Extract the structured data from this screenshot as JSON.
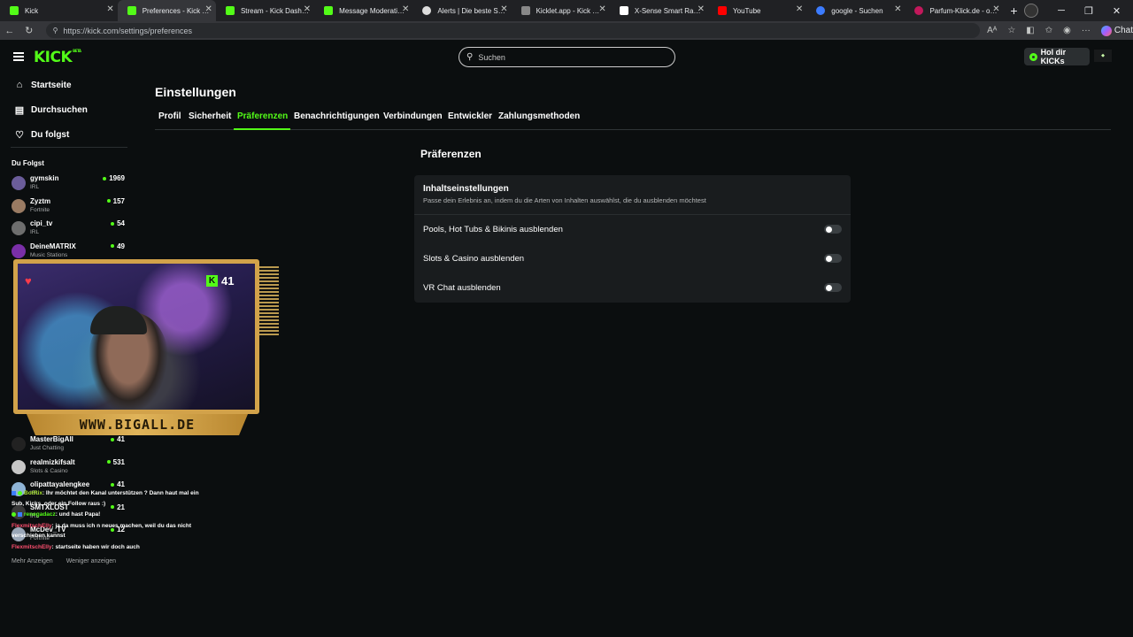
{
  "browser": {
    "tabs": [
      {
        "label": "Kick",
        "color": "#53fc18"
      },
      {
        "label": "Preferences - Kick Stream",
        "color": "#53fc18",
        "active": true
      },
      {
        "label": "Stream - Kick Dashboard",
        "color": "#53fc18"
      },
      {
        "label": "Message Moderation - Ki",
        "color": "#53fc18"
      },
      {
        "label": "Alerts | Die beste Softwar",
        "color": "#dddddd"
      },
      {
        "label": "Kicklet.app - Kick Chatbo",
        "color": "#888888"
      },
      {
        "label": "X-Sense Smart Rauchmel",
        "color": "#ffffff"
      },
      {
        "label": "YouTube",
        "color": "#ff0000"
      },
      {
        "label": "google - Suchen",
        "color": "#3c7cff"
      },
      {
        "label": "Parfum-Klick.de - online-",
        "color": "#c2185b"
      }
    ],
    "url": "https://kick.com/settings/preferences",
    "copilot_label": "Chat"
  },
  "header": {
    "logo": "KICK",
    "logo_badge": "BETA",
    "search_placeholder": "Suchen",
    "kicks_button": "Hol dir KICKs"
  },
  "sidebar": {
    "nav": [
      {
        "label": "Startseite",
        "icon": "home-icon"
      },
      {
        "label": "Durchsuchen",
        "icon": "browse-icon"
      },
      {
        "label": "Du folgst",
        "icon": "heart-icon"
      }
    ],
    "following_heading": "Du Folgst",
    "following": [
      {
        "name": "gymskin",
        "category": "IRL",
        "viewers": "1969",
        "avatar": "#6b5d9a"
      },
      {
        "name": "Zyztm",
        "category": "Fortnite",
        "viewers": "157",
        "avatar": "#9a7b63"
      },
      {
        "name": "cipi_tv",
        "category": "IRL",
        "viewers": "54",
        "avatar": "#6e6e6e"
      },
      {
        "name": "DeineMATRIX",
        "category": "Music Stations",
        "viewers": "49",
        "avatar": "#7a2fa8"
      }
    ],
    "following_lower": [
      {
        "name": "MasterBigAll",
        "category": "Just Chatting",
        "viewers": "41",
        "avatar": "#222222"
      },
      {
        "name": "realmizkifsalt",
        "category": "Slots & Casino",
        "viewers": "531",
        "avatar": "#c7c7c7"
      },
      {
        "name": "olipattayalengkee",
        "category": "IRL",
        "viewers": "41",
        "avatar": "#8fb4d6"
      },
      {
        "name": "SMTXLOST",
        "category": "IRL",
        "viewers": "21",
        "avatar": "#3a3a3a"
      },
      {
        "name": "McDev_TV",
        "category": "Fortnite",
        "viewers": "12",
        "avatar": "#9aa7b8"
      }
    ],
    "show_more": "Mehr Anzeigen",
    "show_less": "Weniger anzeigen"
  },
  "chat": [
    {
      "user": "BotRix",
      "text": ": Ihr möchtet den Kanal unterstützen ? Dann haut mal ein Sub, Kicks, oder ein Follow raus :)"
    },
    {
      "user": "renegadacz",
      "text": ": und hast Papa!"
    },
    {
      "user": "FlexmitschElly",
      "text": ": ja da muss ich n neues machen, weil du das nicht verschieben kannst"
    },
    {
      "user": "FlexmitschElly",
      "text": ": startseite haben wir doch auch"
    }
  ],
  "webcam": {
    "kick_count": "41",
    "banner": "WWW.BIGALL.DE"
  },
  "settings": {
    "title": "Einstellungen",
    "tabs": [
      "Profil",
      "Sicherheit",
      "Präferenzen",
      "Benachrichtigungen",
      "Verbindungen",
      "Entwickler",
      "Zahlungsmethoden"
    ],
    "active_tab": "Präferenzen",
    "section_title": "Präferenzen",
    "card_title": "Inhaltseinstellungen",
    "card_subtitle": "Passe dein Erlebnis an, indem du die Arten von Inhalten auswählst, die du ausblenden möchtest",
    "toggles": [
      {
        "label": "Pools, Hot Tubs & Bikinis ausblenden",
        "on": false
      },
      {
        "label": "Slots & Casino ausblenden",
        "on": false
      },
      {
        "label": "VR Chat ausblenden",
        "on": false
      }
    ]
  },
  "colors": {
    "accent": "#53fc18",
    "background": "#0b0e0f",
    "card": "#191c1e"
  }
}
